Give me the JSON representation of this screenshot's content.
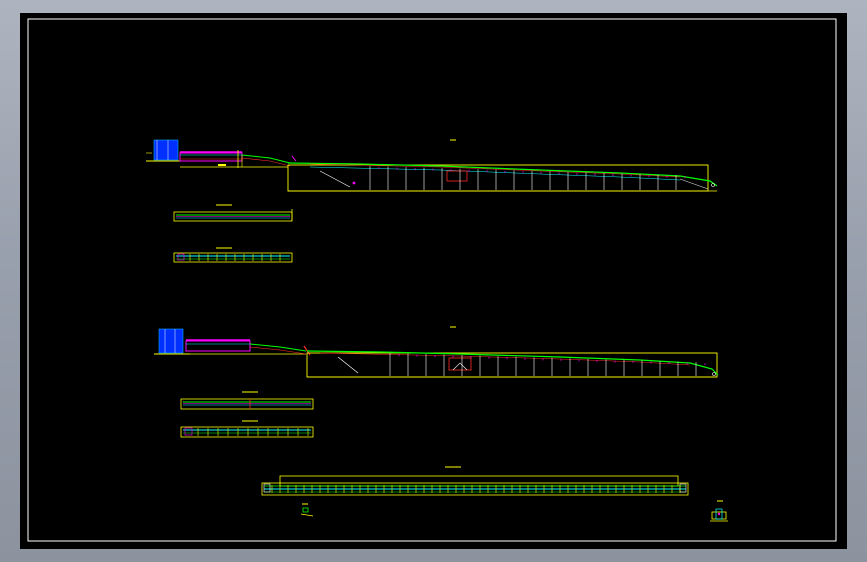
{
  "viewport": {
    "background": "#000000",
    "frame_color": "#ffffff",
    "bezel_color": "#9aa1ad"
  },
  "layer_colors": {
    "outline": "#ffff00",
    "rail": "#00ff00",
    "structure": "#00ffff",
    "equipment": "#0044ff",
    "accent": "#ff00ff",
    "detail": "#ff2a2a",
    "frame": "#ffffff"
  },
  "drawing": {
    "sheet_border": "drawing-border",
    "views": [
      "elevation-view-top",
      "plan-strip-1",
      "plan-strip-2",
      "elevation-view-bottom",
      "plan-strip-3",
      "plan-strip-4",
      "long-section-strip",
      "detail-a",
      "detail-b"
    ]
  }
}
